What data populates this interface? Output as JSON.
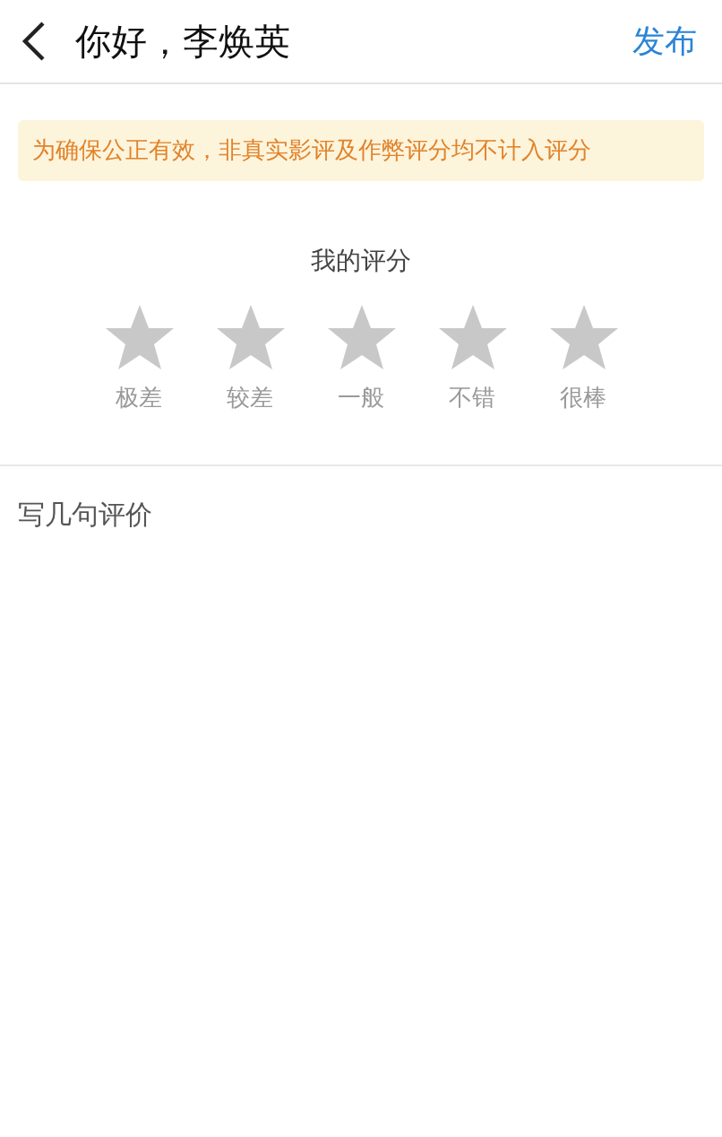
{
  "header": {
    "title": "你好，李焕英",
    "action": "发布"
  },
  "notice": "为确保公正有效，非真实影评及作弊评分均不计入评分",
  "rating": {
    "title": "我的评分",
    "stars": 0,
    "labels": [
      "极差",
      "较差",
      "一般",
      "不错",
      "很棒"
    ]
  },
  "review": {
    "placeholder": "写几句评价"
  }
}
